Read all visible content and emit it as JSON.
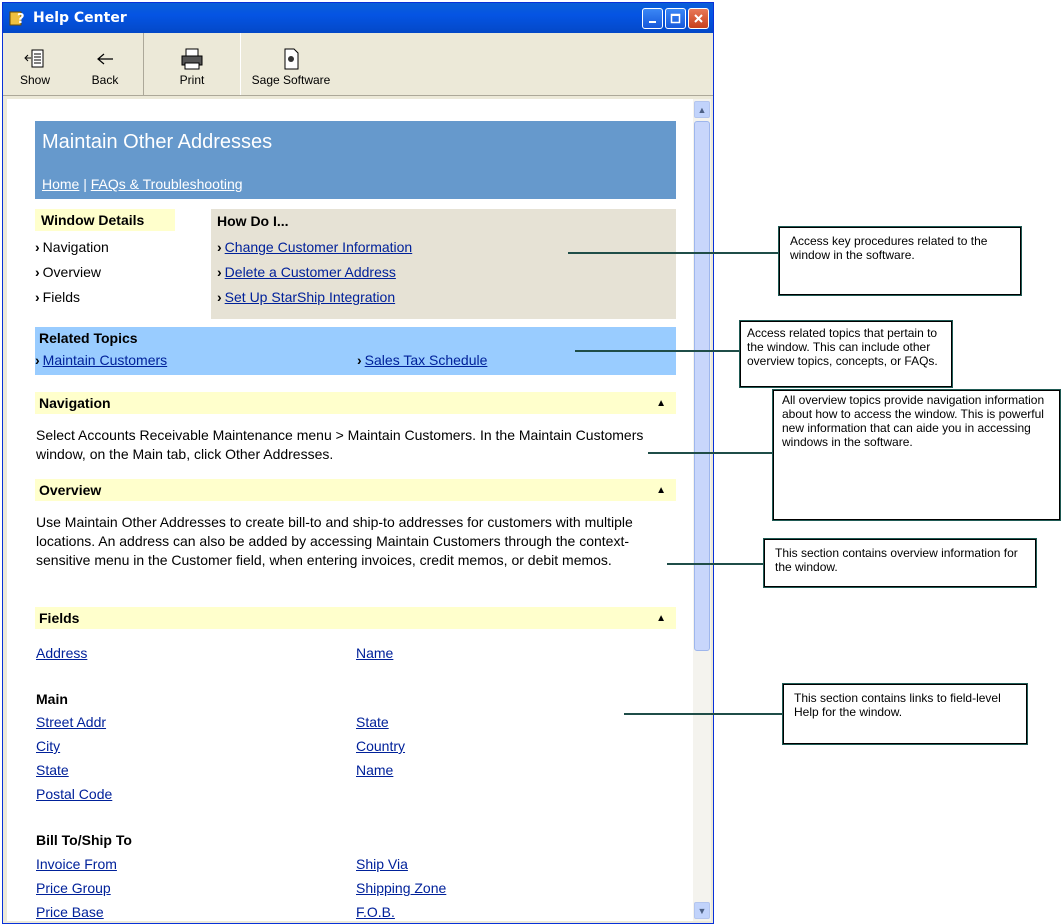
{
  "window": {
    "title": "Help Center"
  },
  "toolbar": {
    "show": "Show",
    "back": "Back",
    "print": "Print",
    "sage": "Sage Software"
  },
  "page": {
    "title": "Maintain Other Addresses",
    "breadcrumb_home": "Home",
    "breadcrumb_sep": "|",
    "breadcrumb_faq": "FAQs & Troubleshooting"
  },
  "window_details": {
    "heading": "Window Details",
    "items": [
      "Navigation",
      "Overview",
      "Fields"
    ]
  },
  "how_do_i": {
    "heading": "How Do I...",
    "items": [
      "Change Customer Information",
      "Delete a Customer Address",
      "Set Up StarShip Integration"
    ]
  },
  "related": {
    "heading": "Related Topics",
    "items": [
      "Maintain Customers",
      "Sales Tax Schedule"
    ]
  },
  "navigation": {
    "heading": "Navigation",
    "text": "Select Accounts Receivable Maintenance menu > Maintain Customers. In the Maintain Customers window, on the Main tab, click Other Addresses."
  },
  "overview": {
    "heading": "Overview",
    "text": "Use Maintain Other Addresses to create bill-to and ship-to addresses for customers with multiple locations. An address can also be added by accessing Maintain Customers through the context-sensitive menu in the Customer field, when entering invoices, credit memos, or debit memos."
  },
  "fields": {
    "heading": "Fields",
    "top": [
      "Address",
      "Name"
    ],
    "main_heading": "Main",
    "main_left": [
      "Street Addr",
      "City",
      "State",
      "Postal Code"
    ],
    "main_right": [
      "State",
      "Country",
      "Name"
    ],
    "bill_heading": "Bill To/Ship To",
    "bill_left": [
      "Invoice From",
      "Price Group",
      "Price Base"
    ],
    "bill_right": [
      "Ship Via",
      "Shipping Zone",
      "F.O.B."
    ]
  },
  "callouts": {
    "how_do_i": "Access key procedures related to the window in the software.",
    "related": "Access related topics that pertain to the window. This can include other overview topics, concepts, or FAQs.",
    "navigation": "All overview topics provide navigation information about how to access the window. This is powerful new information that can aide you in accessing windows in the software.",
    "overview": "This section contains overview information for the window.",
    "fields": "This section contains links to field-level Help for the window."
  }
}
